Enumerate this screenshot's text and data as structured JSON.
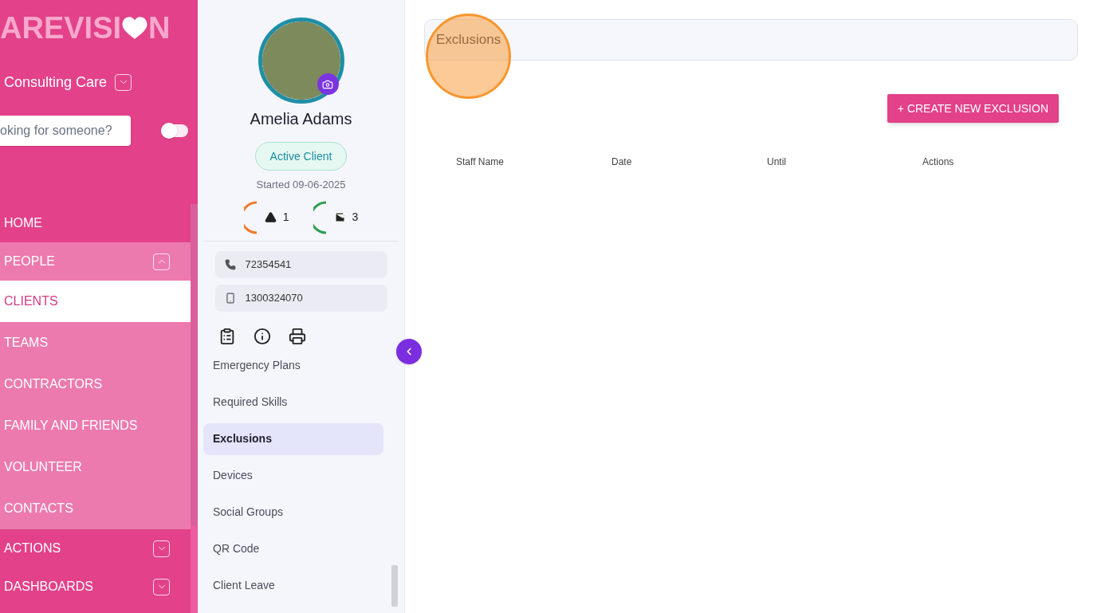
{
  "sidebar": {
    "logo": {
      "before": "AREVISI",
      "after": "N"
    },
    "company": "Consulting Care",
    "search": {
      "placeholder": "oking for someone?"
    },
    "toggle": {
      "on": false
    },
    "items": [
      {
        "label": "HOME",
        "kind": "link"
      },
      {
        "label": "PEOPLE",
        "kind": "group",
        "expanded": true,
        "children": [
          {
            "label": "CLIENTS",
            "selected": true
          },
          {
            "label": "TEAMS",
            "selected": false
          },
          {
            "label": "CONTRACTORS",
            "selected": false
          },
          {
            "label": "FAMILY AND FRIENDS",
            "selected": false
          },
          {
            "label": "VOLUNTEER",
            "selected": false
          },
          {
            "label": "CONTACTS",
            "selected": false
          }
        ]
      },
      {
        "label": "ACTIONS",
        "kind": "group",
        "expanded": false
      },
      {
        "label": "DASHBOARDS",
        "kind": "group",
        "expanded": false
      }
    ]
  },
  "client": {
    "name": "Amelia Adams",
    "status": "Active Client",
    "started": "Started 09-06-2025",
    "stats": [
      {
        "kind": "alerts",
        "value": "1",
        "color": "#f07a2a"
      },
      {
        "kind": "wallet",
        "value": "3",
        "color": "#2e9e4e"
      }
    ],
    "phone": "72354541",
    "mobile": "1300324070",
    "menu": [
      {
        "label": "Emergency Plans",
        "selected": false
      },
      {
        "label": "Required Skills",
        "selected": false
      },
      {
        "label": "Exclusions",
        "selected": true
      },
      {
        "label": "Devices",
        "selected": false
      },
      {
        "label": "Social Groups",
        "selected": false
      },
      {
        "label": "QR Code",
        "selected": false
      },
      {
        "label": "Client Leave",
        "selected": false
      }
    ]
  },
  "main": {
    "title": "Exclusions",
    "create_button": "+ CREATE NEW EXCLUSION",
    "table": {
      "columns": [
        "Staff Name",
        "Date",
        "Until",
        "Actions"
      ]
    }
  }
}
